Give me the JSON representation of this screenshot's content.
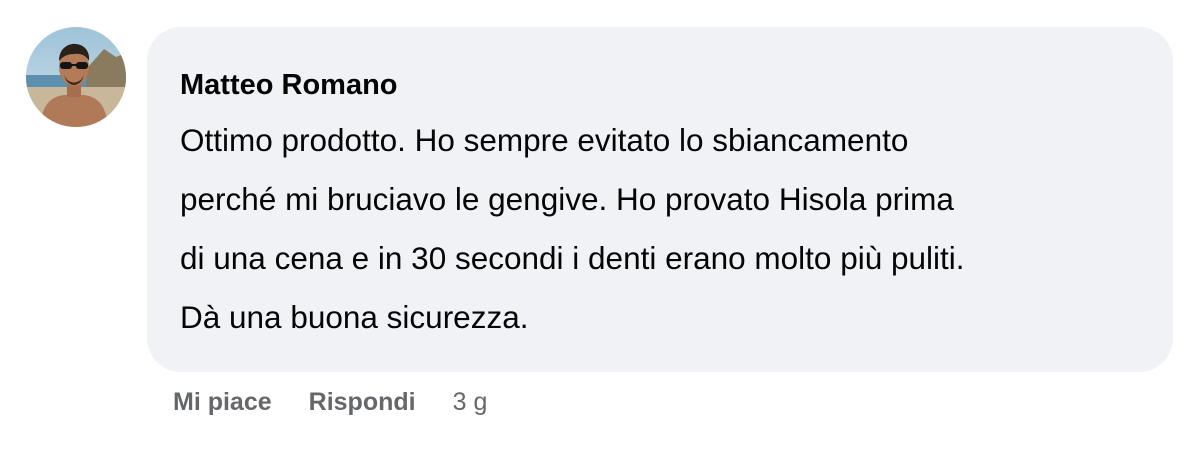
{
  "comment": {
    "avatar_icon": "user-profile-photo",
    "author": "Matteo Romano",
    "text_lines": [
      "Ottimo prodotto. Ho sempre evitato lo sbiancamento",
      "perché mi bruciavo le gengive. Ho provato Hisola prima",
      "di una cena e in 30 secondi i denti erano molto più puliti.",
      "Dà una buona sicurezza."
    ],
    "actions": {
      "like_label": "Mi piace",
      "reply_label": "Rispondi",
      "timestamp": "3 g"
    }
  },
  "colors": {
    "bubble_bg": "#f0f2f5",
    "text": "#050505",
    "secondary": "#65676b"
  }
}
